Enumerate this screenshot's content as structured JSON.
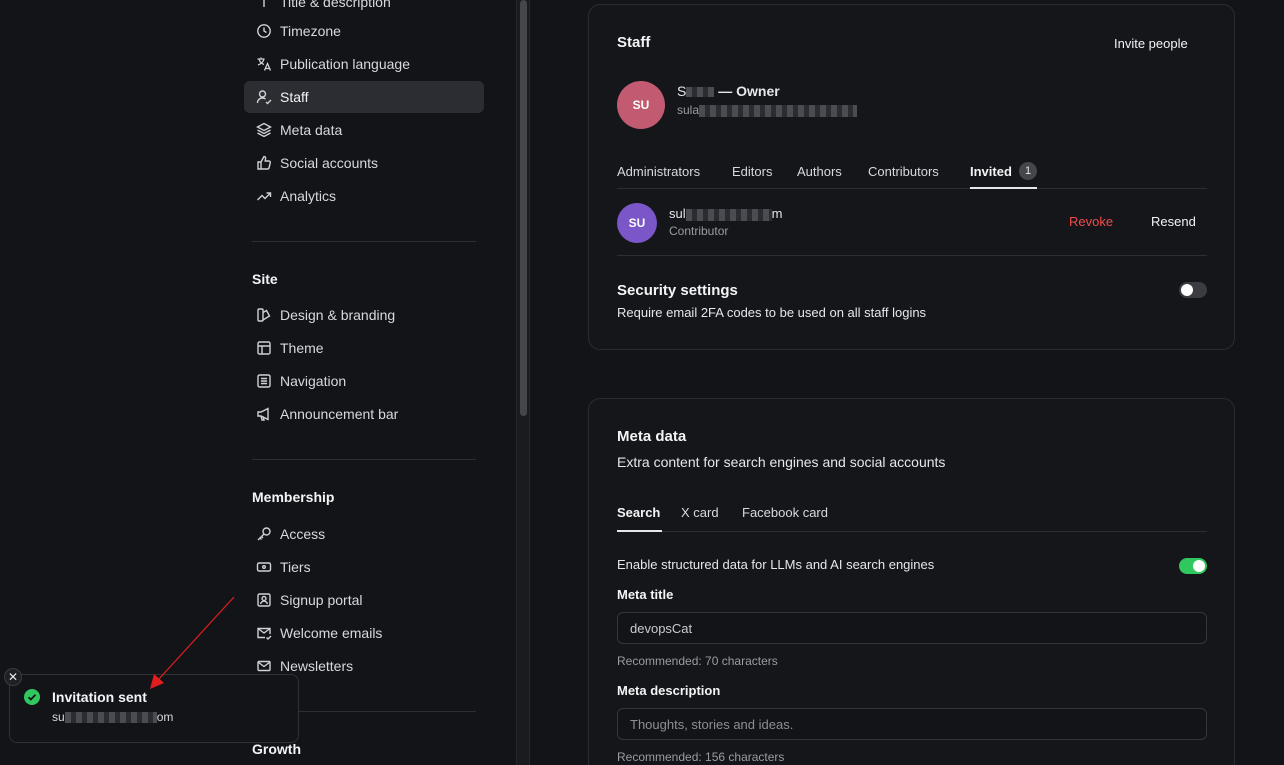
{
  "sidebar": {
    "top_items": [
      {
        "label": "Title & description",
        "icon": "title-icon"
      },
      {
        "label": "Timezone",
        "icon": "clock-icon"
      },
      {
        "label": "Publication language",
        "icon": "translate-icon"
      },
      {
        "label": "Staff",
        "icon": "staff-icon",
        "active": true
      },
      {
        "label": "Meta data",
        "icon": "layers-icon"
      },
      {
        "label": "Social accounts",
        "icon": "thumbs-up-icon"
      },
      {
        "label": "Analytics",
        "icon": "trend-icon"
      }
    ],
    "site_title": "Site",
    "site_items": [
      {
        "label": "Design & branding",
        "icon": "design-icon"
      },
      {
        "label": "Theme",
        "icon": "layout-icon"
      },
      {
        "label": "Navigation",
        "icon": "list-icon"
      },
      {
        "label": "Announcement bar",
        "icon": "megaphone-icon"
      }
    ],
    "membership_title": "Membership",
    "membership_items": [
      {
        "label": "Access",
        "icon": "key-icon"
      },
      {
        "label": "Tiers",
        "icon": "ticket-icon"
      },
      {
        "label": "Signup portal",
        "icon": "portal-icon"
      },
      {
        "label": "Welcome emails",
        "icon": "mail-check-icon"
      },
      {
        "label": "Newsletters",
        "icon": "mail-icon"
      }
    ],
    "growth_title": "Growth"
  },
  "staff": {
    "title": "Staff",
    "invite_label": "Invite people",
    "owner": {
      "initials": "SU",
      "name_prefix": "S",
      "role_text": "— Owner",
      "email_prefix": "sula",
      "avatar_color": "#c25b72"
    },
    "tabs": [
      "Administrators",
      "Editors",
      "Authors",
      "Contributors",
      "Invited"
    ],
    "invited_count": "1",
    "invitee": {
      "initials": "SU",
      "email_prefix": "sul",
      "email_suffix": "m",
      "role": "Contributor",
      "avatar_color": "#7a56c8"
    },
    "revoke_label": "Revoke",
    "resend_label": "Resend",
    "security_title": "Security settings",
    "security_desc": "Require email 2FA codes to be used on all staff logins",
    "security_enabled": false
  },
  "meta": {
    "title": "Meta data",
    "desc": "Extra content for search engines and social accounts",
    "tabs": [
      "Search",
      "X card",
      "Facebook card"
    ],
    "structured_label": "Enable structured data for LLMs and AI search engines",
    "structured_enabled": true,
    "meta_title_label": "Meta title",
    "meta_title_value": "devopsCat",
    "meta_title_hint": "Recommended: 70 characters",
    "meta_desc_label": "Meta description",
    "meta_desc_placeholder": "Thoughts, stories and ideas.",
    "meta_desc_hint": "Recommended: 156 characters"
  },
  "toast": {
    "title": "Invitation sent",
    "email_prefix": "su",
    "email_suffix": "om",
    "close": "✕"
  },
  "colors": {
    "accent_green": "#30c85e",
    "danger": "#f04b4b"
  }
}
